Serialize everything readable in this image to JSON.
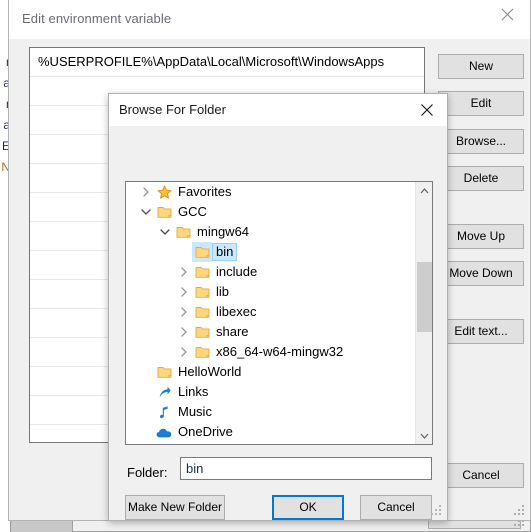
{
  "background_window": {
    "clipped_text_lines": [
      "r",
      "a",
      "r",
      "a",
      "E",
      "N"
    ],
    "cancel_label": "Cancel"
  },
  "env_dialog": {
    "title": "Edit environment variable",
    "close_icon": "close-icon",
    "list_entries": [
      "%USERPROFILE%\\AppData\\Local\\Microsoft\\WindowsApps",
      "",
      "",
      "",
      "",
      "",
      "",
      "",
      "",
      "",
      "",
      "",
      "",
      ""
    ],
    "buttons": {
      "new": "New",
      "edit": "Edit",
      "browse": "Browse...",
      "delete": "Delete",
      "move_up": "Move Up",
      "move_down": "Move Down",
      "edit_text": "Edit text...",
      "cancel": "Cancel"
    }
  },
  "browse_dialog": {
    "title": "Browse For Folder",
    "close_icon": "close-icon",
    "tree": [
      {
        "label": "Favorites",
        "indent": 0,
        "chevron": "collapsed",
        "icon": "star-icon",
        "selected": false
      },
      {
        "label": "GCC",
        "indent": 0,
        "chevron": "expanded",
        "icon": "folder-icon",
        "selected": false
      },
      {
        "label": "mingw64",
        "indent": 1,
        "chevron": "expanded",
        "icon": "folder-icon",
        "selected": false
      },
      {
        "label": "bin",
        "indent": 2,
        "chevron": "none",
        "icon": "folder-icon",
        "selected": true
      },
      {
        "label": "include",
        "indent": 2,
        "chevron": "collapsed",
        "icon": "folder-icon",
        "selected": false
      },
      {
        "label": "lib",
        "indent": 2,
        "chevron": "collapsed",
        "icon": "folder-icon",
        "selected": false
      },
      {
        "label": "libexec",
        "indent": 2,
        "chevron": "collapsed",
        "icon": "folder-icon",
        "selected": false
      },
      {
        "label": "share",
        "indent": 2,
        "chevron": "collapsed",
        "icon": "folder-icon",
        "selected": false
      },
      {
        "label": "x86_64-w64-mingw32",
        "indent": 2,
        "chevron": "collapsed",
        "icon": "folder-icon",
        "selected": false
      },
      {
        "label": "HelloWorld",
        "indent": 0,
        "chevron": "none",
        "icon": "folder-icon",
        "selected": false
      },
      {
        "label": "Links",
        "indent": 0,
        "chevron": "none",
        "icon": "shortcut-icon",
        "selected": false
      },
      {
        "label": "Music",
        "indent": 0,
        "chevron": "none",
        "icon": "music-note-icon",
        "selected": false
      },
      {
        "label": "OneDrive",
        "indent": 0,
        "chevron": "none",
        "icon": "cloud-icon",
        "selected": false
      }
    ],
    "scrollbar": {
      "up_icon": "chevron-up-icon",
      "down_icon": "chevron-down-icon"
    },
    "folder_label": "Folder:",
    "folder_value": "bin",
    "folder_placeholder": "",
    "buttons": {
      "make_new_folder": "Make New Folder",
      "ok": "OK",
      "cancel": "Cancel"
    }
  },
  "colors": {
    "dialog_bg": "#f0f0f0",
    "button_face": "#e1e1e1",
    "button_border": "#adadad",
    "focus_blue": "#0078d7",
    "selection_blue": "#cce8ff",
    "folder_yellow": "#ffd77a",
    "accent_blue": "#1a7fd4",
    "title_gray": "#6b6b75"
  }
}
